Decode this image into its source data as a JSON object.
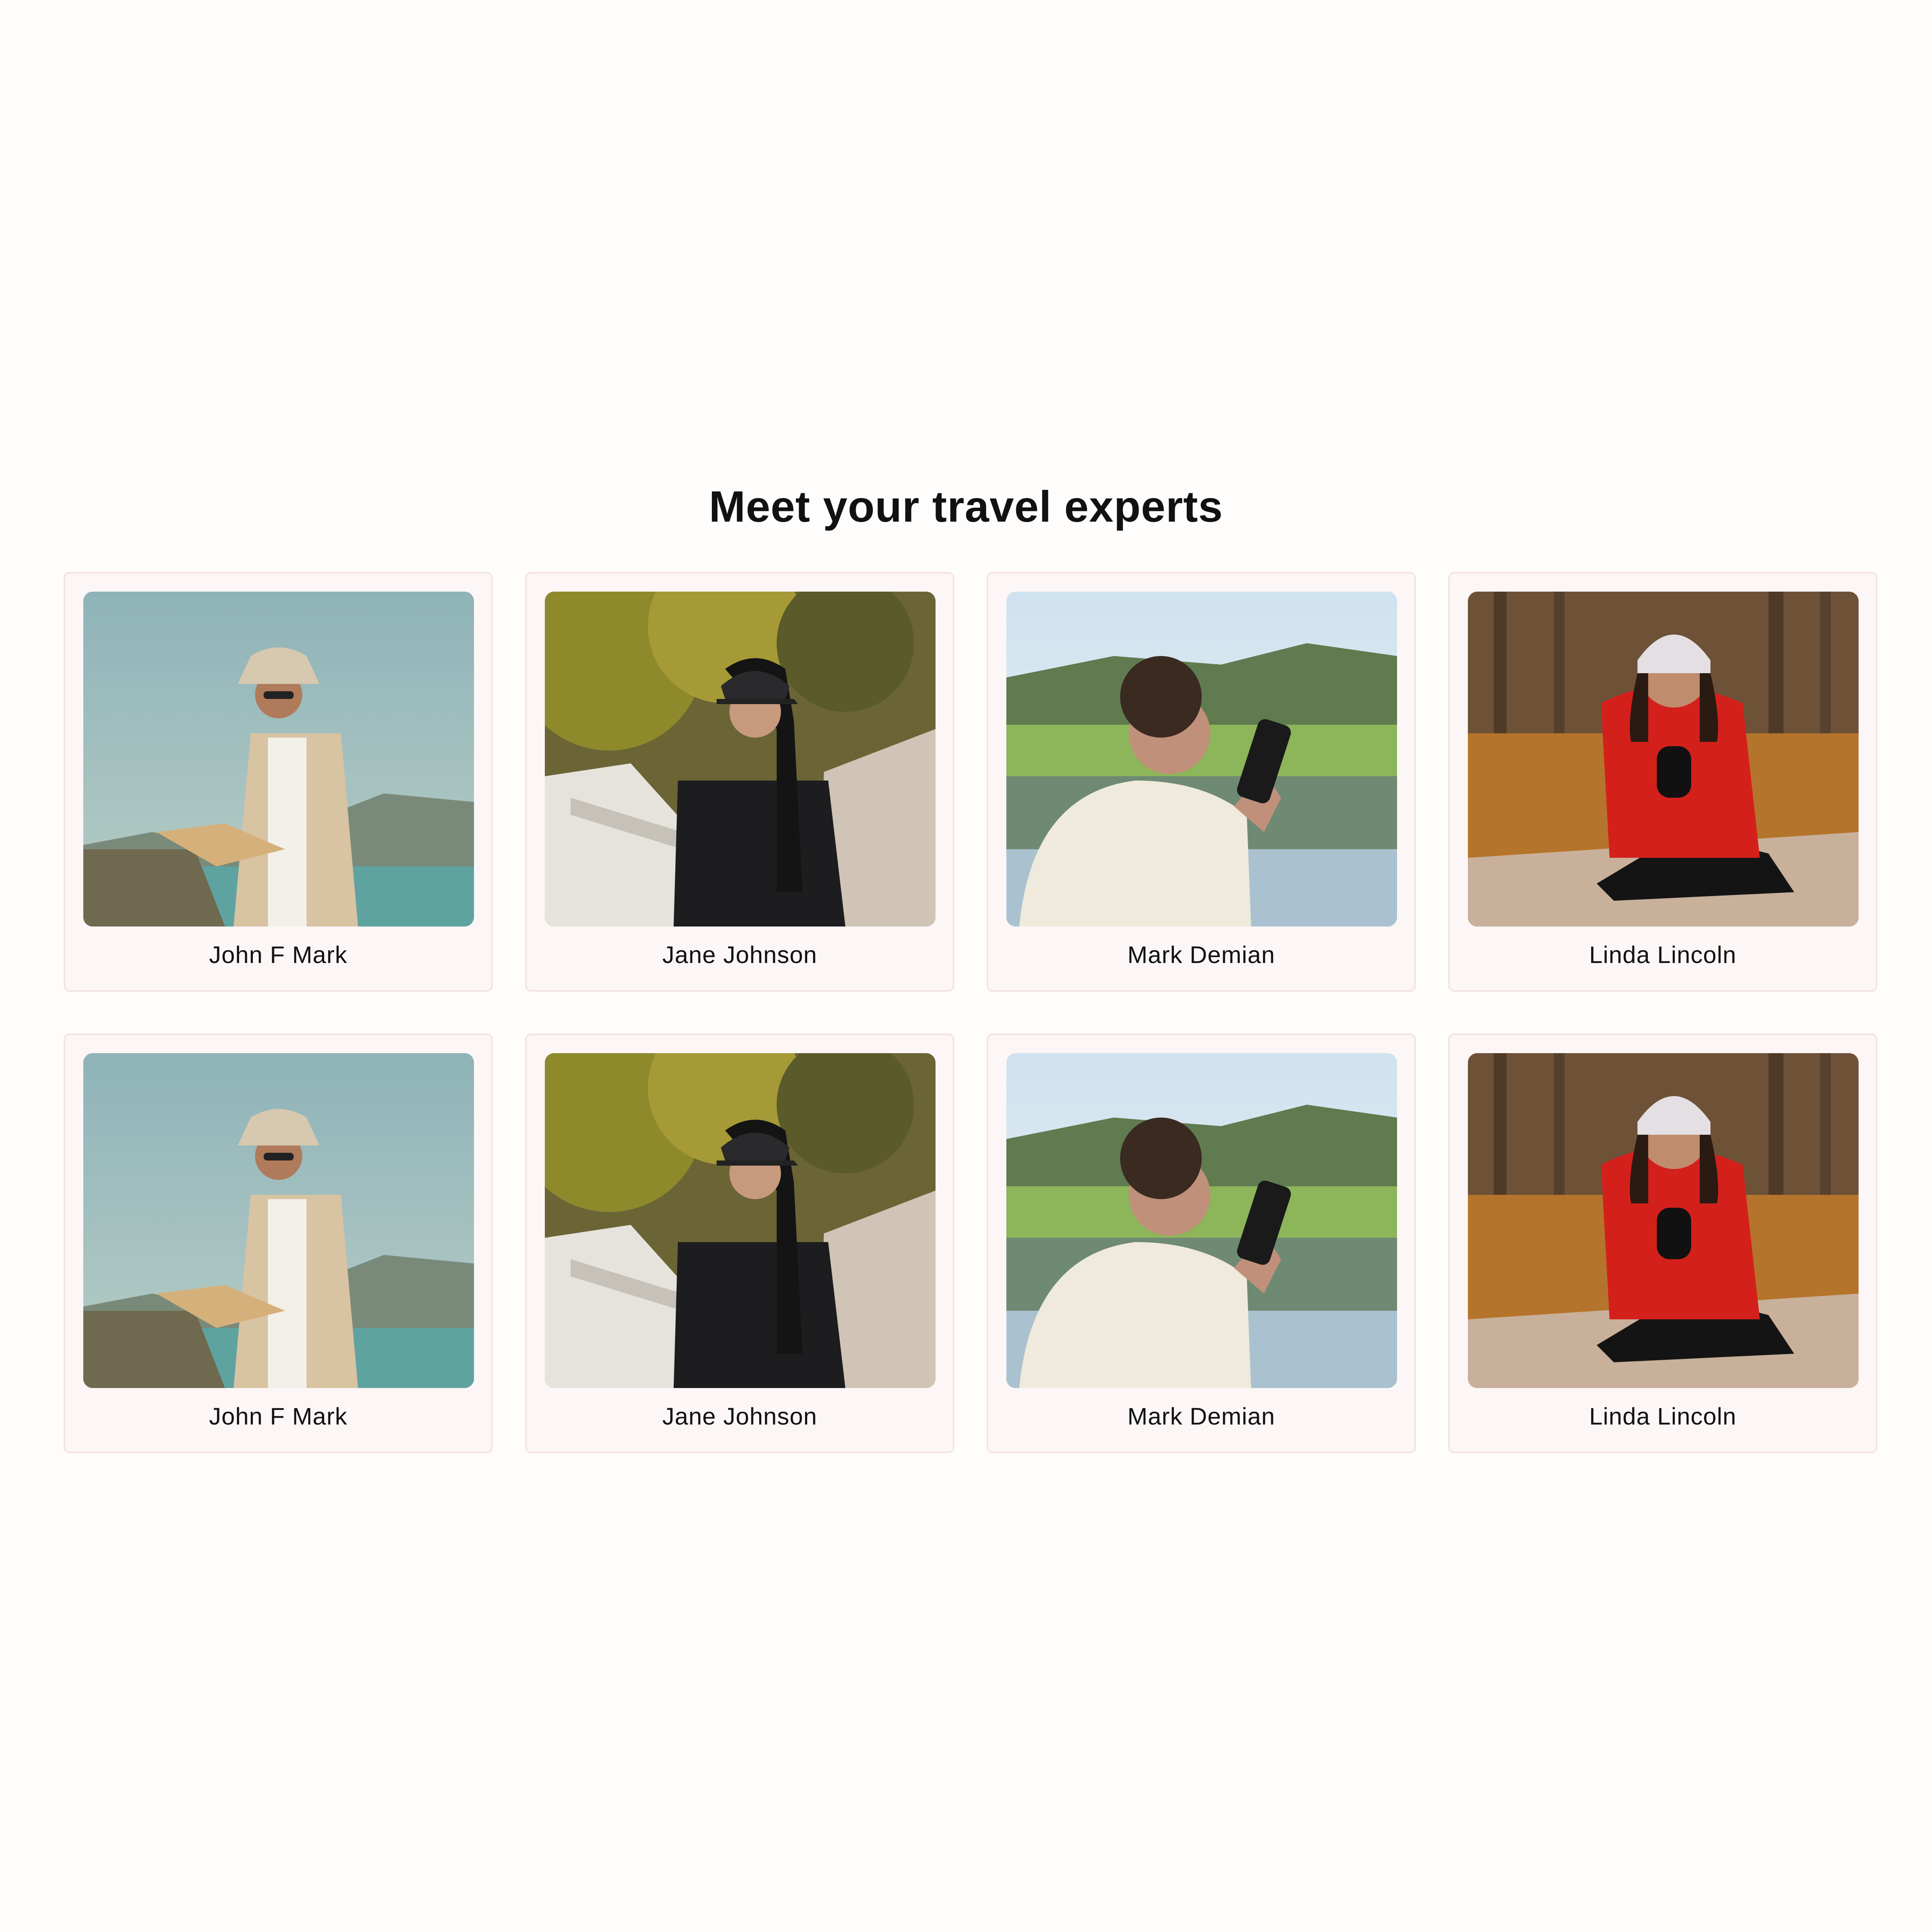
{
  "section": {
    "title": "Meet your travel experts"
  },
  "experts": [
    {
      "name": "John F Mark",
      "photo": "man-bucket-hat-reading-map-by-lake"
    },
    {
      "name": "Jane Johnson",
      "photo": "woman-black-cap-leather-jacket-on-bridge"
    },
    {
      "name": "Mark Demian",
      "photo": "man-holding-camera-by-lake"
    },
    {
      "name": "Linda Lincoln",
      "photo": "woman-red-sweater-beanie-sitting-autumn"
    },
    {
      "name": "John F Mark",
      "photo": "man-bucket-hat-reading-map-by-lake"
    },
    {
      "name": "Jane Johnson",
      "photo": "woman-black-cap-leather-jacket-on-bridge"
    },
    {
      "name": "Mark Demian",
      "photo": "man-holding-camera-by-lake"
    },
    {
      "name": "Linda Lincoln",
      "photo": "woman-red-sweater-beanie-sitting-autumn"
    }
  ],
  "colors": {
    "card_background": "#fcf6f6",
    "card_border": "#f6e4e4",
    "page_background": "#fffdfc"
  }
}
